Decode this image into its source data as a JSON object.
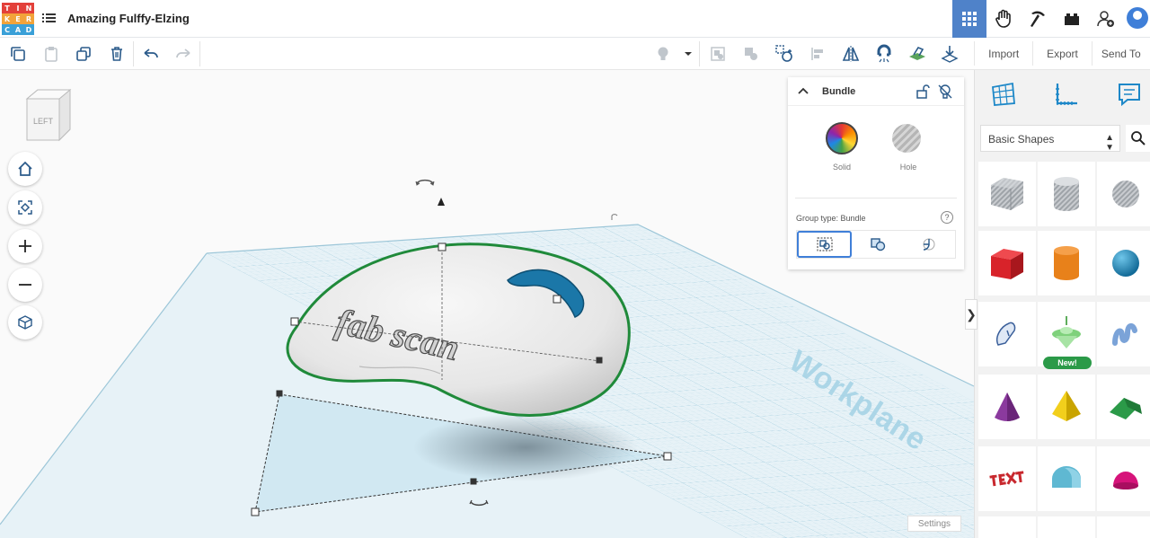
{
  "app": {
    "title": "Amazing Fulffy-Elzing",
    "logo_letters": [
      "T",
      "I",
      "N",
      "K",
      "E",
      "R",
      "C",
      "A",
      "D"
    ],
    "logo_colors": [
      "#e3403a",
      "#e3403a",
      "#e3403a",
      "#f2a33a",
      "#f2a33a",
      "#f2a33a",
      "#3aa0d8",
      "#3aa0d8",
      "#3aa0d8"
    ]
  },
  "header": {
    "buttons": [
      {
        "name": "3d-design-view-button",
        "icon": "grid-icon",
        "active": true
      },
      {
        "name": "sim-lab-button",
        "icon": "hand-icon"
      },
      {
        "name": "minecraft-button",
        "icon": "pickaxe-icon"
      },
      {
        "name": "bricks-button",
        "icon": "brick-icon"
      },
      {
        "name": "invite-user-button",
        "icon": "user-add-icon"
      },
      {
        "name": "profile-avatar",
        "icon": "avatar-icon"
      }
    ]
  },
  "toolbar": {
    "tools": [
      "copy",
      "paste",
      "duplicate",
      "delete",
      "undo",
      "redo",
      "show-hidden",
      "dropdown",
      "group",
      "ungroup",
      "cruise",
      "align",
      "mirror",
      "magnet",
      "workplane",
      "drop"
    ],
    "import_label": "Import",
    "export_label": "Export",
    "sendto_label": "Send To"
  },
  "viewcube": {
    "face_label": "LEFT"
  },
  "canvas": {
    "workplane_label": "Workplane",
    "settings_label": "Settings",
    "model_text": "fab scan"
  },
  "inspector": {
    "title": "Bundle",
    "solid_label": "Solid",
    "hole_label": "Hole",
    "group_type_label": "Group type: Bundle",
    "help_label": "?"
  },
  "panel": {
    "library_label": "Basic Shapes",
    "new_badge": "New!",
    "shapes": [
      {
        "name": "box-hole",
        "color": "#b4b8bd"
      },
      {
        "name": "cylinder-hole",
        "color": "#b4b8bd"
      },
      {
        "name": "sphere-hole",
        "color": "#b4b8bd"
      },
      {
        "name": "box",
        "color": "#d8232a"
      },
      {
        "name": "cylinder",
        "color": "#e8811a"
      },
      {
        "name": "sphere",
        "color": "#1e8fc6"
      },
      {
        "name": "scribble",
        "color": "#5b84c9"
      },
      {
        "name": "new-shape",
        "color": "#6fcf6c"
      },
      {
        "name": "text-wave",
        "color": "#7ba3d8"
      },
      {
        "name": "cone",
        "color": "#8b3a9e"
      },
      {
        "name": "pyramid",
        "color": "#e8c200"
      },
      {
        "name": "roof",
        "color": "#2b9a48"
      },
      {
        "name": "text",
        "color": "#c8282e"
      },
      {
        "name": "half-cylinder",
        "color": "#5fb8d2"
      },
      {
        "name": "paraboloid",
        "color": "#d6137a"
      }
    ]
  }
}
